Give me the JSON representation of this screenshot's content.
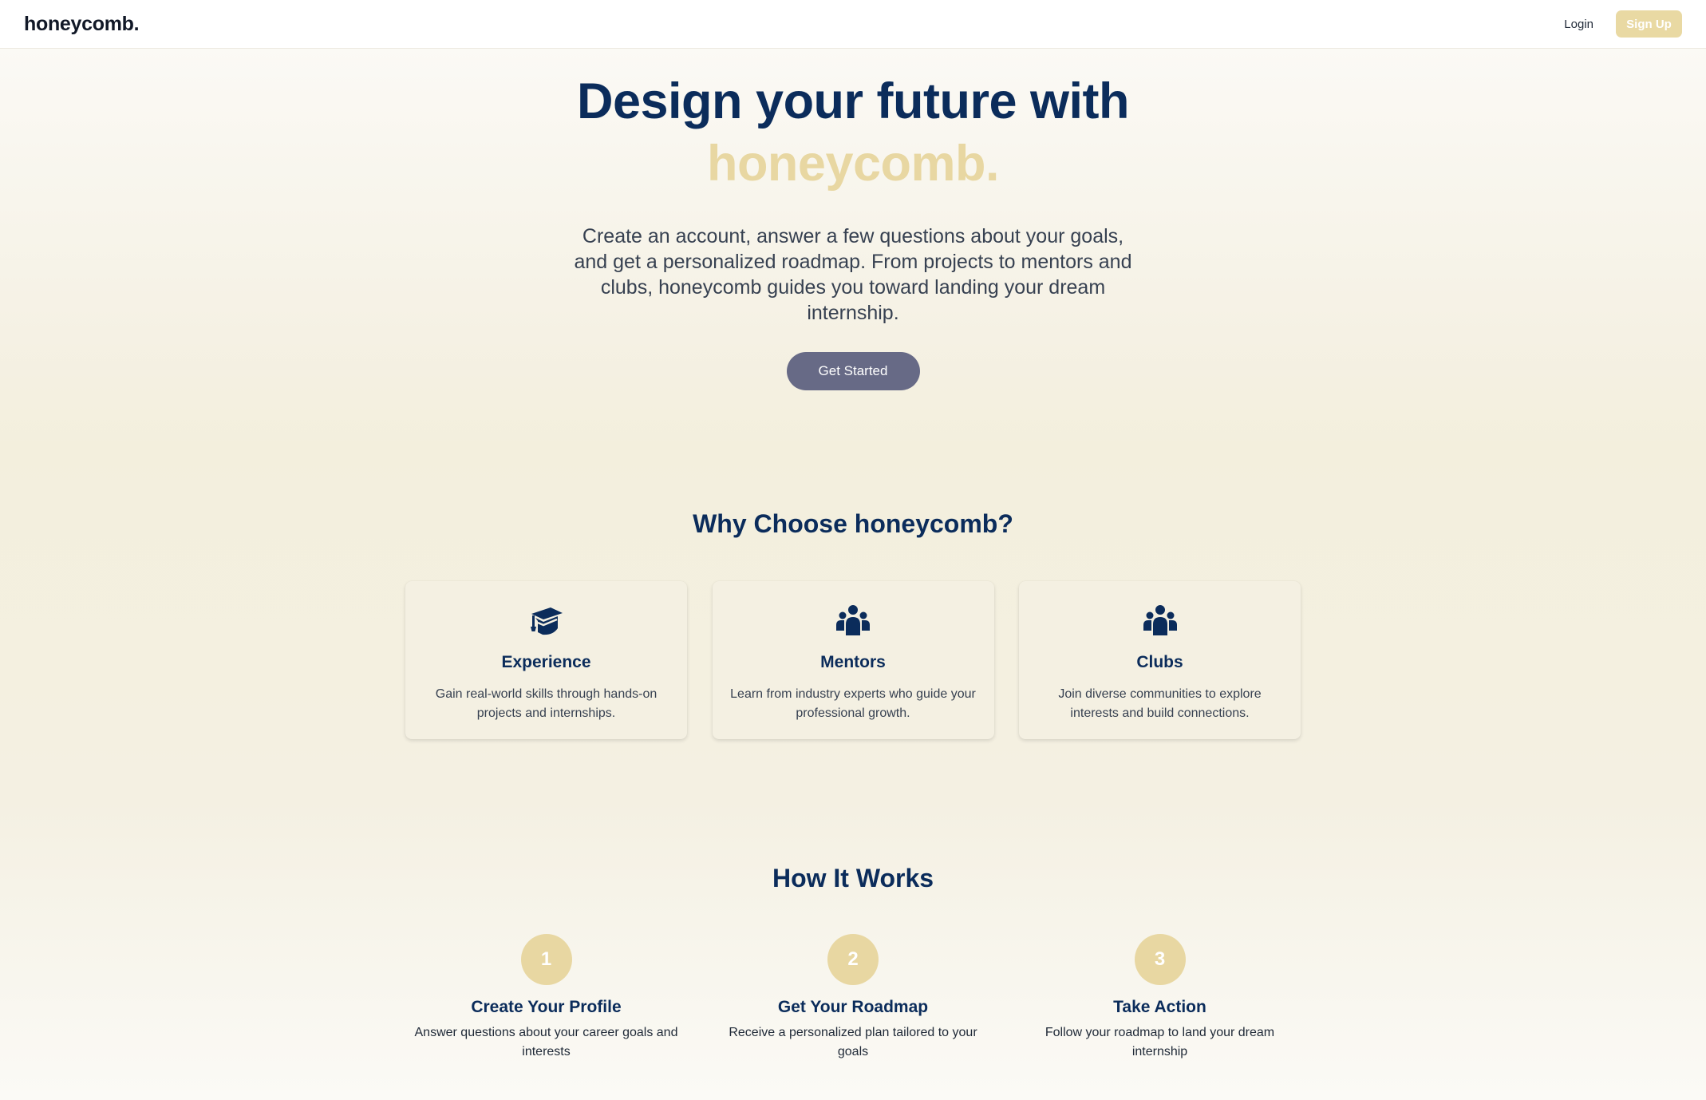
{
  "nav": {
    "logo": "honeycomb.",
    "login": "Login",
    "signup": "Sign Up"
  },
  "hero": {
    "title_line1": "Design your future with",
    "title_accent": "honeycomb.",
    "description": "Create an account, answer a few questions about your goals, and get a personalized roadmap. From projects to mentors and clubs, honeycomb guides you toward landing your dream internship.",
    "cta": "Get Started"
  },
  "why": {
    "title": "Why Choose honeycomb?",
    "features": [
      {
        "icon": "graduation-cap-icon",
        "title": "Experience",
        "description": "Gain real-world skills through hands-on projects and internships."
      },
      {
        "icon": "people-group-icon",
        "title": "Mentors",
        "description": "Learn from industry experts who guide your professional growth."
      },
      {
        "icon": "people-group-icon",
        "title": "Clubs",
        "description": "Join diverse communities to explore interests and build connections."
      }
    ]
  },
  "how": {
    "title": "How It Works",
    "steps": [
      {
        "number": "1",
        "title": "Create Your Profile",
        "description": "Answer questions about your career goals and interests"
      },
      {
        "number": "2",
        "title": "Get Your Roadmap",
        "description": "Receive a personalized plan tailored to your goals"
      },
      {
        "number": "3",
        "title": "Take Action",
        "description": "Follow your roadmap to land your dream internship"
      }
    ]
  },
  "colors": {
    "navy": "#0b2c5b",
    "gold": "#e8d7a2",
    "button": "#676a86"
  }
}
